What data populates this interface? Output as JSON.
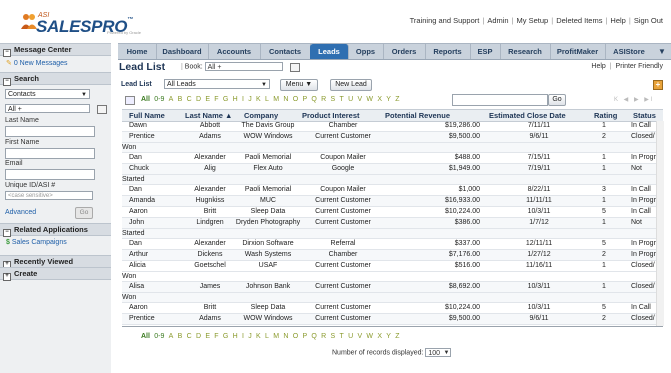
{
  "logo": {
    "asi": "ASI",
    "word": "SALESPRO",
    "tm": "™",
    "powered": "Powered by Oracle"
  },
  "toplinks": [
    "Training and Support",
    "Admin",
    "My Setup",
    "Deleted Items",
    "Help",
    "Sign Out"
  ],
  "tabs": [
    "Home",
    "Dashboard",
    "Accounts",
    "Contacts",
    "Leads",
    "Opps",
    "Orders",
    "Reports",
    "ESP",
    "Research",
    "ProfitMaker",
    "ASIStore"
  ],
  "tab_menu_glyph": "▼",
  "active_tab": "Leads",
  "sidebar": {
    "message_center": "Message Center",
    "new_messages": "0 New Messages",
    "search": "Search",
    "search_type": "Contacts",
    "search_all": "All +",
    "last_name": "Last Name",
    "first_name": "First Name",
    "email": "Email",
    "unique_id": "Unique ID/ASI #",
    "case_placeholder": "<case sensitive>",
    "advanced": "Advanced",
    "go": "Go",
    "related_apps": "Related Applications",
    "sales_campaigns": "Sales Campaigns",
    "recently_viewed": "Recently Viewed",
    "create": "Create",
    "box_minus": "−",
    "box_plus": "+",
    "arrow": "▼"
  },
  "main": {
    "title": "Lead List",
    "book_label": "Book:",
    "book_value": "All +",
    "help": "Help",
    "printer": "Printer Friendly",
    "sep": "|",
    "lead_list_label": "Lead List",
    "lead_list_value": "All Leads",
    "menu_btn": "Menu ▼",
    "new_lead_btn": "New Lead",
    "add_glyph": "+",
    "go": "Go",
    "pager": "K ◀ ▶ ▶I",
    "records_label": "Number of records displayed:",
    "records_value": "100"
  },
  "alphabet": [
    "All",
    "0-9",
    "A",
    "B",
    "C",
    "D",
    "E",
    "F",
    "G",
    "H",
    "I",
    "J",
    "K",
    "L",
    "M",
    "N",
    "O",
    "P",
    "Q",
    "R",
    "S",
    "T",
    "U",
    "V",
    "W",
    "X",
    "Y",
    "Z"
  ],
  "columns": [
    "Full Name",
    "Last Name ▲",
    "Company",
    "Product Interest",
    "Potential Revenue",
    "Estimated Close Date",
    "Rating",
    "Status"
  ],
  "rows": [
    {
      "first": "Dawn",
      "last": "Abbott",
      "company": "The Davis Group",
      "product": "Chamber",
      "revenue": "$19,286.00",
      "close": "7/11/11",
      "rating": "1",
      "status": "In Call"
    },
    {
      "first": "Prentice",
      "last": "Adams",
      "company": "WOW Windows",
      "product": "Current Customer",
      "revenue": "$9,500.00",
      "close": "9/6/11",
      "rating": "2",
      "status": "Closed/",
      "wrap": "Won"
    },
    {
      "first": "Dan",
      "last": "Alexander",
      "company": "Paoli Memorial",
      "product": "Coupon Mailer",
      "revenue": "$488.00",
      "close": "7/15/11",
      "rating": "1",
      "status": "In Progress"
    },
    {
      "first": "Chuck",
      "last": "Alig",
      "company": "Flex Auto",
      "product": "Google",
      "revenue": "$1,949.00",
      "close": "7/19/11",
      "rating": "1",
      "status": "Not",
      "wrap": "Started"
    },
    {
      "first": "Dan",
      "last": "Alexander",
      "company": "Paoli Memorial",
      "product": "Coupon Mailer",
      "revenue": "$1,000",
      "close": "8/22/11",
      "rating": "3",
      "status": "In Call"
    },
    {
      "first": "Amanda",
      "last": "Hugnkiss",
      "company": "MUC",
      "product": "Current Customer",
      "revenue": "$16,933.00",
      "close": "11/11/11",
      "rating": "1",
      "status": "In Progress"
    },
    {
      "first": "Aaron",
      "last": "Britt",
      "company": "Sleep Data",
      "product": "Current Customer",
      "revenue": "$10,224.00",
      "close": "10/3/11",
      "rating": "5",
      "status": "In Call"
    },
    {
      "first": "John",
      "last": "Lindgren",
      "company": "Dryden Photography",
      "product": "Current Customer",
      "revenue": "$386.00",
      "close": "1/7/12",
      "rating": "1",
      "status": "Not",
      "wrap": "Started"
    },
    {
      "first": "Dan",
      "last": "Alexander",
      "company": "Dirxion Software",
      "product": "Referral",
      "revenue": "$337.00",
      "close": "12/11/11",
      "rating": "5",
      "status": "In Progress"
    },
    {
      "first": "Arthur",
      "last": "Dickens",
      "company": "Wash Systems",
      "product": "Chamber",
      "revenue": "$7,176.00",
      "close": "1/27/12",
      "rating": "2",
      "status": "In Progress"
    },
    {
      "first": "Alicia",
      "last": "Goetschel",
      "company": "USAF",
      "product": "Current Customer",
      "revenue": "$516.00",
      "close": "11/16/11",
      "rating": "1",
      "status": "Closed/",
      "wrap": "Won"
    },
    {
      "first": "Alisa",
      "last": "James",
      "company": "Johnson Bank",
      "product": "Current Customer",
      "revenue": "$8,692.00",
      "close": "10/3/11",
      "rating": "1",
      "status": "Closed/",
      "wrap": "Won"
    },
    {
      "first": "Aaron",
      "last": "Britt",
      "company": "Sleep Data",
      "product": "Current Customer",
      "revenue": "$10,224.00",
      "close": "10/3/11",
      "rating": "5",
      "status": "In Call"
    },
    {
      "first": "Prentice",
      "last": "Adams",
      "company": "WOW Windows",
      "product": "Current Customer",
      "revenue": "$9,500.00",
      "close": "9/6/11",
      "rating": "2",
      "status": "Closed/"
    }
  ]
}
